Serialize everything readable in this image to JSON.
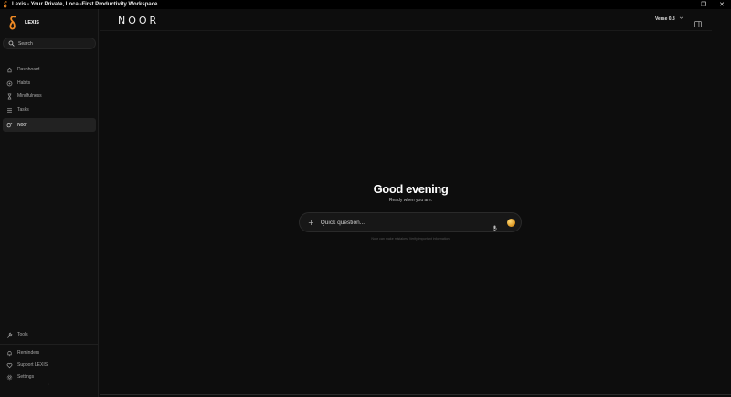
{
  "window": {
    "title": "Lexis - Your Private, Local-First Productivity Workspace",
    "controls": {
      "minimize": "—",
      "maximize": "❐",
      "close": "✕"
    }
  },
  "brand": {
    "name": "LEXIS",
    "accent": "#f08a24"
  },
  "sidebar": {
    "search_label": "Search",
    "items": [
      {
        "label": "Dashboard",
        "icon": "home-icon"
      },
      {
        "label": "Habits",
        "icon": "target-icon"
      },
      {
        "label": "Mindfulness",
        "icon": "hourglass-icon"
      },
      {
        "label": "Tasks",
        "icon": "list-icon"
      },
      {
        "label": "Noor",
        "icon": "sparkle-icon",
        "active": true
      }
    ],
    "bottom_items": [
      {
        "label": "Tools",
        "icon": "wrench-icon"
      },
      {
        "label": "Reminders",
        "icon": "bell-icon"
      },
      {
        "label": "Support LEXIS",
        "icon": "heart-icon"
      },
      {
        "label": "Settings",
        "icon": "gear-icon"
      }
    ]
  },
  "main": {
    "logo": "NOOR",
    "model_selector": "Verse 0.8",
    "greeting": "Good evening",
    "subgreeting": "Ready when you are.",
    "input_placeholder": "Quick question...",
    "footnote": "Noor can make mistakes. Verify important information."
  }
}
